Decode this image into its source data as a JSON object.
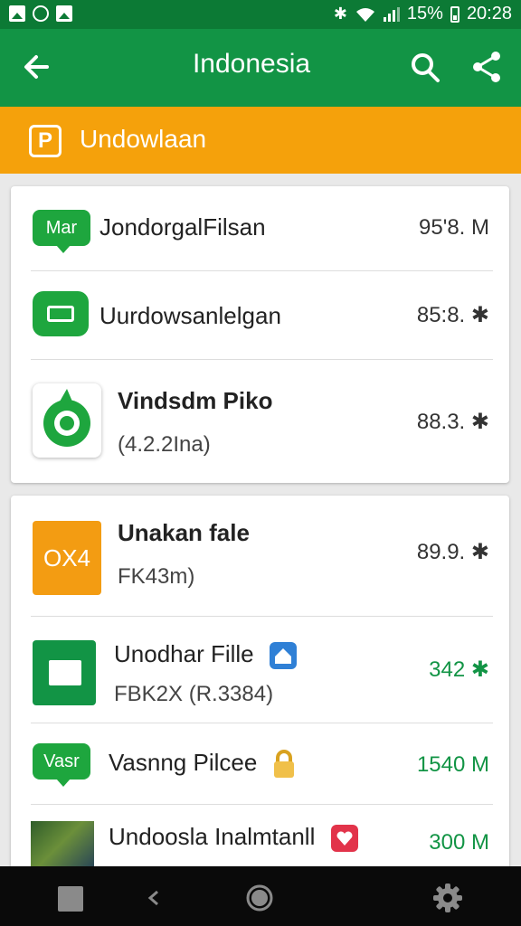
{
  "status_bar": {
    "battery": "15%",
    "time": "20:28",
    "bluetooth_icon": "bluetooth-icon",
    "wifi_icon": "wifi-icon",
    "signal_icon": "signal-icon",
    "battery_icon": "battery-icon"
  },
  "app_bar": {
    "title": "Indonesia",
    "back_icon": "arrow-left-icon",
    "search_icon": "search-icon",
    "share_icon": "share-icon",
    "color": "#129445"
  },
  "banner": {
    "icon_text": "P",
    "label": "Undowlaan",
    "color": "#f5a10b"
  },
  "card1": {
    "rows": [
      {
        "icon_text": "Mar",
        "name": "JondorgalFilsan",
        "size": "95'8. M"
      },
      {
        "name": "Uurdowsanlelgan",
        "size": "85:8. ✱"
      },
      {
        "name": "Vindsdm Piko",
        "sub": "(4.2.2Ina)",
        "size": "88.3. ✱"
      }
    ]
  },
  "card2": {
    "rows": [
      {
        "icon_text": "OX4",
        "name": "Unakan fale",
        "sub": "FK43m)",
        "size": "89.9. ✱"
      },
      {
        "name": "Unodhar Fille",
        "sub": "FBK2X (R.3384)",
        "size": "342 ✱"
      },
      {
        "icon_text": "Vasr",
        "name": "Vasnng Pilcee",
        "size": "1540 M"
      },
      {
        "name": "Undoosla Inalmtanll",
        "size": "300 M"
      }
    ]
  },
  "accent_green": "#129445",
  "size_green": "#129445"
}
